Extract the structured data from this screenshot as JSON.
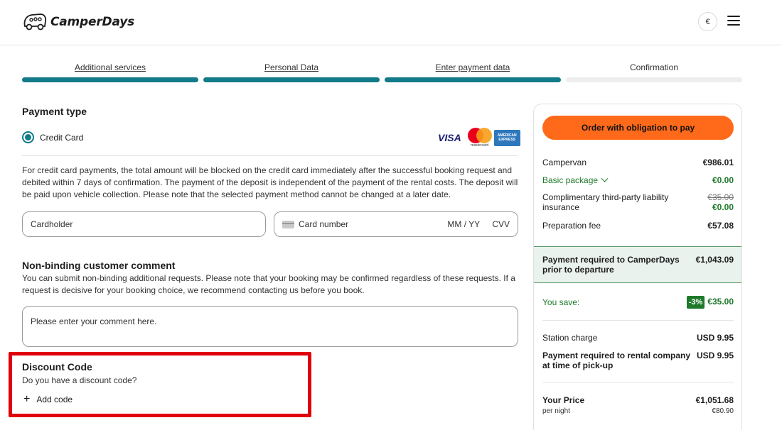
{
  "header": {
    "brand": "CamperDays",
    "currency": "€"
  },
  "steps": [
    {
      "label": "Additional services",
      "state": "done"
    },
    {
      "label": "Personal Data",
      "state": "done"
    },
    {
      "label": "Enter payment data",
      "state": "done"
    },
    {
      "label": "Confirmation",
      "state": "pending"
    }
  ],
  "payment": {
    "title": "Payment type",
    "option_label": "Credit Card",
    "card_brands": {
      "visa": "VISA",
      "mastercard": "mastercard",
      "amex_line1": "AMERICAN",
      "amex_line2": "EXPRESS"
    },
    "info": "For credit card payments, the total amount will be blocked on the credit card immediately after the successful booking request and debited within 7 days of confirmation. The payment of the deposit is independent of the payment of the rental costs. The deposit will be paid upon vehicle collection. Please note that the selected payment method cannot be changed at a later date.",
    "cardholder_placeholder": "Cardholder",
    "card_number_placeholder": "Card number",
    "expiry_placeholder": "MM / YY",
    "cvv_placeholder": "CVV"
  },
  "comment": {
    "title": "Non-binding customer comment",
    "info": "You can submit non-binding additional requests. Please note that your booking may be confirmed regardless of these requests. If a request is decisive for your booking choice, we recommend contacting us before you book.",
    "placeholder": "Please enter your comment here."
  },
  "discount": {
    "title": "Discount Code",
    "subtitle": "Do you have a discount code?",
    "add_label": "Add code"
  },
  "summary": {
    "order_button": "Order with obligation to pay",
    "campervan_label": "Campervan",
    "campervan_value": "€986.01",
    "basic_label": "Basic package",
    "basic_value": "€0.00",
    "liability_label": "Complimentary third-party liability insurance",
    "liability_old": "€35.00",
    "liability_value": "€0.00",
    "prep_label": "Preparation fee",
    "prep_value": "€57.08",
    "req_label": "Payment required to CamperDays prior to departure",
    "req_value": "€1,043.09",
    "save_label": "You save:",
    "save_badge": "-3%",
    "save_value": "€35.00",
    "station_label": "Station charge",
    "station_value": "USD 9.95",
    "rental_label": "Payment required to rental company at time of pick-up",
    "rental_value": "USD 9.95",
    "price_label": "Your Price",
    "price_value": "€1,051.68",
    "per_night_label": "per night",
    "per_night_value": "€80.90"
  },
  "colors": {
    "accent": "#137a88",
    "cta": "#ff6a1a",
    "green": "#1e7a2a",
    "highlight": "#e0000c"
  }
}
